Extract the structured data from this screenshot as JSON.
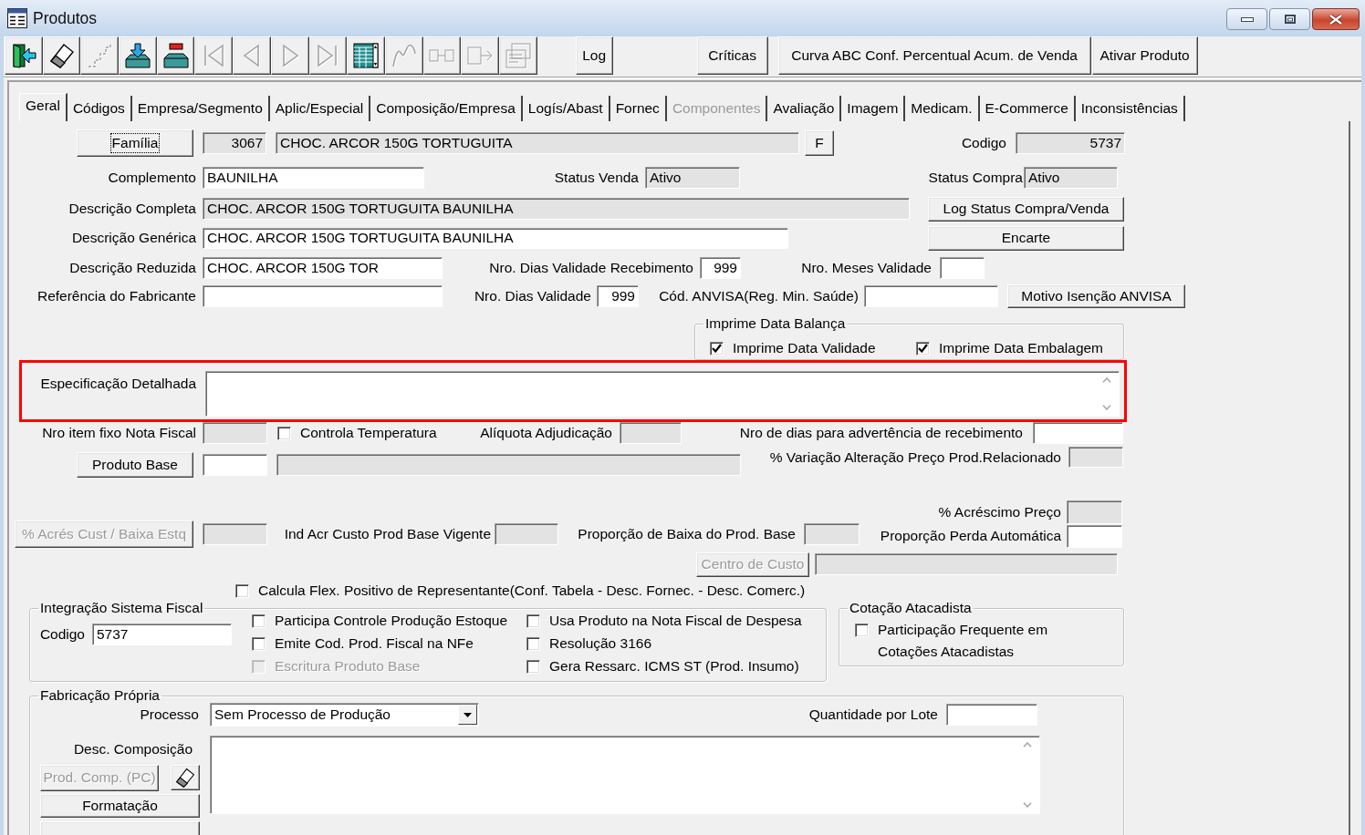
{
  "window": {
    "title": "Produtos"
  },
  "toolbar": {
    "icon_buttons": [
      {
        "kind": "exit",
        "disabled": false
      },
      {
        "kind": "eraser",
        "disabled": false
      },
      {
        "kind": "steps",
        "disabled": true
      },
      {
        "kind": "tray_in",
        "disabled": false
      },
      {
        "kind": "tray_remove",
        "disabled": false
      },
      {
        "kind": "first",
        "disabled": true
      },
      {
        "kind": "prev",
        "disabled": true
      },
      {
        "kind": "next",
        "disabled": true
      },
      {
        "kind": "last",
        "disabled": true
      },
      {
        "kind": "grid",
        "disabled": false
      },
      {
        "kind": "curve",
        "disabled": true
      },
      {
        "kind": "linked",
        "disabled": true
      },
      {
        "kind": "box_arrow",
        "disabled": true
      },
      {
        "kind": "cards",
        "disabled": true
      }
    ],
    "buttons": [
      "Log",
      "Críticas",
      "Curva ABC Conf. Percentual Acum. de Venda",
      "Ativar Produto"
    ]
  },
  "tabs": [
    {
      "label": "Geral",
      "selected": true,
      "disabled": false
    },
    {
      "label": "Códigos",
      "selected": false,
      "disabled": false
    },
    {
      "label": "Empresa/Segmento",
      "selected": false,
      "disabled": false
    },
    {
      "label": "Aplic/Especial",
      "selected": false,
      "disabled": false
    },
    {
      "label": "Composição/Empresa",
      "selected": false,
      "disabled": false
    },
    {
      "label": "Logís/Abast",
      "selected": false,
      "disabled": false
    },
    {
      "label": "Fornec",
      "selected": false,
      "disabled": false
    },
    {
      "label": "Componentes",
      "selected": false,
      "disabled": true
    },
    {
      "label": "Avaliação",
      "selected": false,
      "disabled": false
    },
    {
      "label": "Imagem",
      "selected": false,
      "disabled": false
    },
    {
      "label": "Medicam.",
      "selected": false,
      "disabled": false
    },
    {
      "label": "E-Commerce",
      "selected": false,
      "disabled": false
    },
    {
      "label": "Inconsistências",
      "selected": false,
      "disabled": false
    }
  ],
  "form": {
    "familia": {
      "button": "Família",
      "focused": true,
      "code": {
        "value": "3067",
        "readonly": true
      },
      "name": {
        "value": "CHOC. ARCOR 150G TORTUGUITA",
        "readonly": true
      },
      "search_button": "F"
    },
    "codigo": {
      "label": "Codigo",
      "value": "5737",
      "readonly": true
    },
    "complemento": {
      "label": "Complemento",
      "value": "BAUNILHA",
      "readonly": false
    },
    "status_venda": {
      "label": "Status Venda",
      "value": "Ativo",
      "readonly": true
    },
    "status_compra": {
      "label": "Status Compra",
      "value": "Ativo",
      "readonly": true
    },
    "descricao_completa": {
      "label": "Descrição Completa",
      "value": "CHOC. ARCOR 150G TORTUGUITA BAUNILHA",
      "readonly": true
    },
    "log_status_button": "Log Status Compra/Venda",
    "descricao_generica": {
      "label": "Descrição Genérica",
      "value": "CHOC. ARCOR 150G TORTUGUITA BAUNILHA",
      "readonly": false
    },
    "encarte_button": "Encarte",
    "descricao_reduzida": {
      "label": "Descrição Reduzida",
      "value": "CHOC. ARCOR 150G TOR",
      "readonly": false
    },
    "dias_validade_recebimento": {
      "label": "Nro. Dias Validade Recebimento",
      "value": "999",
      "readonly": false
    },
    "meses_validade": {
      "label": "Nro. Meses Validade",
      "readonly": false
    },
    "referencia_fabricante": {
      "label": "Referência do Fabricante",
      "readonly": false
    },
    "dias_validade": {
      "label": "Nro. Dias Validade",
      "value": "999",
      "readonly": false
    },
    "cod_anvisa": {
      "label": "Cód. ANVISA(Reg. Min. Saúde)",
      "readonly": false
    },
    "motivo_isencao_button": "Motivo Isenção ANVISA",
    "imprime_data_balanca": {
      "title": "Imprime Data Balança",
      "options": [
        {
          "label": "Imprime Data Validade",
          "checked": true
        },
        {
          "label": "Imprime Data Embalagem",
          "checked": true
        }
      ]
    },
    "especificacao_detalhada": {
      "label": "Especificação Detalhada",
      "highlighted": true
    },
    "nro_item_fixo": {
      "label": "Nro item fixo Nota Fiscal",
      "readonly": true
    },
    "controla_temperatura": {
      "label": "Controla Temperatura",
      "checked": false
    },
    "aliquota_adjudicacao": {
      "label": "Alíquota Adjudicação",
      "readonly": true
    },
    "dias_advertencia": {
      "label": "Nro de dias para advertência de recebimento",
      "readonly": false
    },
    "variacao_preco": {
      "label": "% Variação Alteração Preço Prod.Relacionado",
      "readonly": true
    },
    "produto_base": {
      "button": "Produto Base",
      "code": {
        "readonly": false
      },
      "name": {
        "readonly": true
      }
    },
    "acrescimo_preco": {
      "label": "% Acréscimo Preço",
      "readonly": true
    },
    "acres_cust": {
      "button": "% Acrés Cust / Baixa Estq",
      "disabled": true,
      "field": {
        "readonly": true
      }
    },
    "ind_acr_custo": {
      "label": "Ind Acr Custo Prod Base Vigente",
      "readonly": true
    },
    "proporcao_baixa": {
      "label": "Proporção de Baixa do Prod. Base",
      "readonly": true
    },
    "proporcao_perda": {
      "label": "Proporção Perda Automática",
      "readonly": false
    },
    "centro_custo": {
      "button": "Centro de Custo",
      "disabled": true,
      "field": {
        "readonly": true
      }
    },
    "calcula_flex": {
      "label": "Calcula Flex. Positivo de Representante(Conf. Tabela - Desc. Fornec. - Desc. Comerc.)",
      "checked": false
    },
    "integracao_sistema_fiscal": {
      "title": "Integração Sistema Fiscal",
      "codigo": {
        "label": "Codigo",
        "value": "5737",
        "readonly": false
      },
      "options": [
        {
          "label": "Participa Controle Produção Estoque",
          "checked": false,
          "disabled": false
        },
        {
          "label": "Usa Produto na Nota Fiscal de Despesa",
          "checked": false,
          "disabled": false
        },
        {
          "label": "Emite Cod. Prod. Fiscal na NFe",
          "checked": false,
          "disabled": false
        },
        {
          "label": "Resolução 3166",
          "checked": false,
          "disabled": false
        },
        {
          "label": "Escritura Produto Base",
          "checked": false,
          "disabled": true
        },
        {
          "label": "Gera Ressarc. ICMS ST (Prod. Insumo)",
          "checked": false,
          "disabled": false
        }
      ]
    },
    "cotacao_atacadista": {
      "title": "Cotação Atacadista",
      "options": [
        {
          "label": "Participação Frequente em Cotações Atacadistas",
          "checked": false
        }
      ]
    },
    "fabricacao_propria": {
      "title": "Fabricação Própria",
      "processo": {
        "label": "Processo",
        "value": "Sem Processo de Produção"
      },
      "quantidade_por_lote": {
        "label": "Quantidade por Lote",
        "readonly": false
      },
      "desc_composicao": {
        "label": "Desc. Composição"
      },
      "buttons": [
        {
          "kind": "text",
          "label": "Prod. Comp. (PC)",
          "disabled": true
        },
        {
          "kind": "eraser",
          "disabled": false
        },
        {
          "kind": "text",
          "label": "Formatação",
          "disabled": false
        },
        {
          "kind": "text"
        }
      ]
    }
  }
}
